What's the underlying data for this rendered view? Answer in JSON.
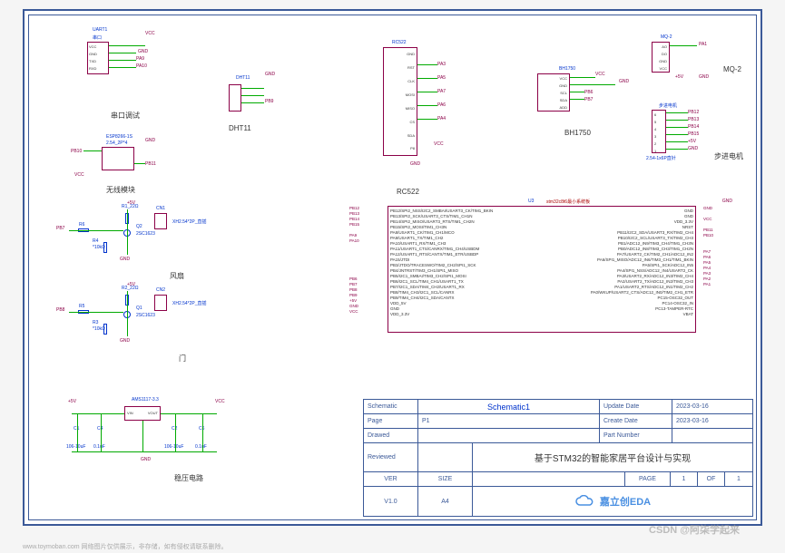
{
  "sections": {
    "uart": {
      "title": "串口调试",
      "ref": "UART1",
      "sub": "串口",
      "pwr": [
        "VCC",
        "GND"
      ],
      "nets": [
        "PA9",
        "PA10"
      ],
      "pins": [
        "VCC",
        "GND",
        "TXD",
        "RXD"
      ]
    },
    "dht11": {
      "title": "DHT11",
      "ref": "DHT11",
      "pwr": [
        "GND"
      ],
      "nets": [
        "PB9"
      ]
    },
    "wifi": {
      "title": "无线模块",
      "ref": "ESP8266-1S",
      "sub": "2.54_2P*4",
      "pwr": [
        "GND",
        "VCC"
      ],
      "nets": [
        "PB10",
        "PB11"
      ]
    },
    "fan": {
      "title": "风扇",
      "refs": [
        "R6",
        "R1_22Ω",
        "CN1",
        "Q2",
        "2SC1623",
        "R4",
        "*10kΩ",
        "XH2.54*2P_直插"
      ],
      "pwr": [
        "+5V",
        "GND"
      ],
      "nets": [
        "PB7"
      ]
    },
    "door": {
      "title": "门",
      "refs": [
        "R5",
        "R2_22Ω",
        "CN2",
        "Q1",
        "2SC1623",
        "R3",
        "*10kΩ",
        "XH2.54*2P_直插"
      ],
      "pwr": [
        "+5V",
        "GND"
      ],
      "nets": [
        "PB8"
      ]
    },
    "vreg": {
      "title": "稳压电路",
      "ref": "AMS1117-3.3",
      "pins": [
        "VIN",
        "VOUT"
      ],
      "pwr": [
        "+5V",
        "GND",
        "VCC"
      ],
      "caps": [
        "C1",
        "106-10uF",
        "C4",
        "0.1uF",
        "C2",
        "106-10uF",
        "C6",
        "0.1uF"
      ]
    },
    "rc522": {
      "title": "RC522",
      "ref": "RC522",
      "pins": [
        "GND",
        "RST",
        "CLK",
        "MOSI",
        "MISO",
        "CS",
        "SDA",
        "P8"
      ],
      "nets": [
        "PA3",
        "PA5",
        "PA7",
        "PA6",
        "PA4"
      ],
      "pwr": [
        "GND",
        "VCC"
      ]
    },
    "bh1750": {
      "title": "BH1750",
      "ref": "BH1750",
      "pins": [
        "VCC",
        "GND",
        "SCL",
        "SDA",
        "ADD"
      ],
      "pwr": [
        "VCC",
        "GND"
      ],
      "nets": [
        "PB6",
        "PB7"
      ]
    },
    "mq2": {
      "title": "MQ-2",
      "ref": "MQ-2",
      "pins": [
        "AO",
        "DO",
        "GND",
        "VCC"
      ],
      "pwr": [
        "+5V",
        "GND"
      ],
      "nets": [
        "PA1"
      ]
    },
    "stepper": {
      "title": "步进电机",
      "ref": "步进电机",
      "sub": "2.54-1x6P直针",
      "pins": [
        "6",
        "5",
        "4",
        "3",
        "2",
        "1"
      ],
      "nets": [
        "PB12",
        "PB13",
        "PB14",
        "PB15"
      ],
      "pwr": [
        "+5V",
        "GND"
      ]
    },
    "mcu": {
      "ref": "U3",
      "sub": "stm32c8t6最小系统板",
      "left_pins": [
        "PB12/SPI2_NSS/I2C2_SMBAI/USART3_CK/TIM1_BKIN",
        "PB13/SPI2_SCK/USART3_CTS/TIM1_CH1N",
        "PB14/SPI2_MISO/USART3_RTS/TIM1_CH2N",
        "PB15/SPI2_MOSI/TIM1_CH3N",
        "PA8/USART1_CK/TIM1_CH1/MCO",
        "PA9/USART1_TX/TIM1_CH2",
        "PA10/USART1_RX/TIM1_CH3",
        "PA11/USART1_CTS/CANRX/TIM1_CH4/USBDM",
        "PA12/USART1_RTS/CANTX/TIM1_ETR/USBDP",
        "PA15/JTDI",
        "PB3/JTDO/TRACESWO/TIM2_CH2/SPI1_SCK",
        "PB4/JNTRST/TIM3_CH1/SPI1_MISO",
        "PB5/I2C1_SMBAI/TIM3_CH2/SPI1_MOSI",
        "PB6/I2C1_SCL/TIM4_CH1/USART1_TX",
        "PB7/I2C1_SDA/TIM4_CH2/USART1_RX",
        "PB8/TIM4_CH3/I2C1_SCL/CANRX",
        "PB9/TIM4_CH4/I2C1_SDA/CANTX",
        "VDD_5V",
        "GND",
        "VDD_3.3V"
      ],
      "right_pins": [
        "GND",
        "GND",
        "VDD_3.3V",
        "NRST",
        "PB11/I2C2_SDA/USART3_RX/TIM2_CH4",
        "PB10/I2C2_SCL/USART3_TX/TIM2_CH3",
        "PB1/ADC12_IN9/TIM3_CH4/TIM1_CH3N",
        "PB0/ADC12_IN8/TIM3_CH3/TIM1_CH2N",
        "PA7/USART2_CK/TIM2_CH1/ADC12_IN2",
        "PA6/SPI1_MISO/ADC12_IN6/TIM3_CH1/TIM1_BKIN",
        "PA5/SPI1_SCK/ADC12_IN5",
        "PA4/SPI1_NSS/ADC12_IN4/USART2_CK",
        "PA3/USART2_RX/ADC12_IN3/TIM2_CH4",
        "PA2/USART2_TX/ADC12_IN2/TIM2_CH3",
        "PA1/USART2_RTS/ADC12_IN1/TIM2_CH2",
        "PA0/WKUP/USART2_CTS/ADC12_IN0/TIM2_CH1_ETR",
        "PC15-OSC32_OUT",
        "PC14-OSC32_IN",
        "PC13-TAMPER-RTC",
        "VBAT"
      ],
      "left_nets": [
        "PB12",
        "PB13",
        "PB14",
        "PB15",
        "",
        "PA9",
        "PA10",
        "",
        "",
        "",
        "",
        "",
        "",
        "PB6",
        "PB7",
        "PB8",
        "PB9",
        "+5V",
        "GND",
        "VCC"
      ],
      "right_nets": [
        "GND",
        "",
        "VCC",
        "",
        "PB11",
        "PB10",
        "",
        "",
        "PA7",
        "PA6",
        "PA5",
        "PA4",
        "PA3",
        "PA2",
        "PA1",
        "",
        "",
        "",
        "",
        ""
      ]
    }
  },
  "titleblock": {
    "schematic_label": "Schematic",
    "schematic_value": "Schematic1",
    "page_label": "Page",
    "page_value": "P1",
    "drawed_label": "Drawed",
    "reviewed_label": "Reviewed",
    "update_label": "Update Date",
    "update_value": "2023-03-16",
    "create_label": "Create Date",
    "create_value": "2023-03-16",
    "partnum_label": "Part Number",
    "project_title": "基于STM32的智能家居平台设计与实现",
    "ver_label": "VER",
    "ver_value": "V1.0",
    "size_label": "SIZE",
    "size_value": "A4",
    "pageof_label": "PAGE",
    "page_num": "1",
    "of_label": "OF",
    "of_num": "1",
    "eda_name": "嘉立创EDA"
  },
  "watermark": "www.toymoban.com  网络图片仅供展示，非存储，如有侵权请联系删除。",
  "csdn": "CSDN @阿柒学起来"
}
